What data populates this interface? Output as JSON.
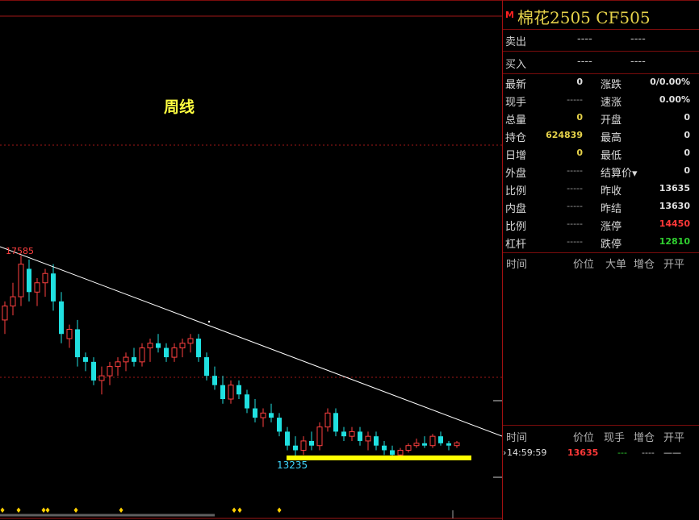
{
  "chart_data": {
    "type": "candlestick",
    "period_label": "周线",
    "high_label": "17585",
    "low_label": "13235",
    "candles": [
      [
        16200,
        16600,
        15900,
        16500
      ],
      [
        16500,
        17000,
        16300,
        16700
      ],
      [
        16700,
        17585,
        16500,
        17400
      ],
      [
        17300,
        17500,
        16600,
        16800
      ],
      [
        16800,
        17100,
        16500,
        17000
      ],
      [
        17000,
        17300,
        16700,
        17200
      ],
      [
        17200,
        17400,
        16400,
        16600
      ],
      [
        16600,
        16800,
        15700,
        15900
      ],
      [
        15800,
        16100,
        15600,
        16000
      ],
      [
        16000,
        16200,
        15200,
        15400
      ],
      [
        15400,
        15500,
        15100,
        15300
      ],
      [
        15300,
        15400,
        14800,
        14900
      ],
      [
        14900,
        15200,
        14600,
        15000
      ],
      [
        15000,
        15300,
        14800,
        15200
      ],
      [
        15200,
        15400,
        15000,
        15300
      ],
      [
        15300,
        15500,
        15100,
        15400
      ],
      [
        15400,
        15600,
        15200,
        15300
      ],
      [
        15300,
        15700,
        15200,
        15600
      ],
      [
        15600,
        15800,
        15300,
        15700
      ],
      [
        15700,
        15900,
        15500,
        15600
      ],
      [
        15600,
        15700,
        15300,
        15400
      ],
      [
        15400,
        15700,
        15300,
        15600
      ],
      [
        15600,
        15800,
        15400,
        15700
      ],
      [
        15700,
        15900,
        15500,
        15800
      ],
      [
        15800,
        15900,
        15300,
        15400
      ],
      [
        15400,
        15500,
        14900,
        15000
      ],
      [
        15000,
        15200,
        14700,
        14800
      ],
      [
        14800,
        15000,
        14400,
        14500
      ],
      [
        14500,
        14900,
        14400,
        14800
      ],
      [
        14800,
        14900,
        14500,
        14600
      ],
      [
        14600,
        14700,
        14200,
        14300
      ],
      [
        14300,
        14500,
        14000,
        14100
      ],
      [
        14100,
        14300,
        13900,
        14200
      ],
      [
        14200,
        14400,
        14000,
        14100
      ],
      [
        14100,
        14200,
        13700,
        13800
      ],
      [
        13800,
        13900,
        13400,
        13500
      ],
      [
        13500,
        13700,
        13235,
        13400
      ],
      [
        13400,
        13700,
        13300,
        13600
      ],
      [
        13600,
        13800,
        13400,
        13500
      ],
      [
        13500,
        14000,
        13400,
        13900
      ],
      [
        13900,
        14300,
        13800,
        14200
      ],
      [
        14200,
        14300,
        13700,
        13800
      ],
      [
        13800,
        13900,
        13600,
        13700
      ],
      [
        13700,
        13900,
        13600,
        13800
      ],
      [
        13800,
        13900,
        13500,
        13600
      ],
      [
        13600,
        13800,
        13400,
        13700
      ],
      [
        13700,
        13800,
        13400,
        13500
      ],
      [
        13500,
        13600,
        13300,
        13400
      ],
      [
        13400,
        13500,
        13250,
        13300
      ],
      [
        13300,
        13450,
        13250,
        13400
      ],
      [
        13400,
        13550,
        13350,
        13500
      ],
      [
        13500,
        13650,
        13450,
        13550
      ],
      [
        13550,
        13700,
        13450,
        13500
      ],
      [
        13500,
        13750,
        13450,
        13700
      ],
      [
        13700,
        13800,
        13500,
        13550
      ],
      [
        13550,
        13600,
        13400,
        13500
      ],
      [
        13500,
        13600,
        13450,
        13560
      ]
    ],
    "colors": {
      "up": "#ff4040",
      "down": "#20e0e0",
      "trendline": "#ffffff",
      "support": "#ffff00",
      "grid": "#a01818"
    }
  },
  "panel": {
    "title": "棉花2505  CF505",
    "badge": "M",
    "sell": {
      "label": "卖出",
      "price": "----",
      "volume": "----"
    },
    "buy": {
      "label": "买入",
      "price": "----",
      "volume": "----"
    },
    "rows": [
      {
        "l1": "最新",
        "v1": "0",
        "v1c": "white",
        "l2": "涨跌",
        "v2": "0/0.00%",
        "v2c": "white"
      },
      {
        "l1": "现手",
        "v1": "-----",
        "v1c": "dash",
        "l2": "速涨",
        "v2": "0.00%",
        "v2c": "white"
      },
      {
        "l1": "总量",
        "v1": "0",
        "v1c": "yellow",
        "l2": "开盘",
        "v2": "0",
        "v2c": "white"
      },
      {
        "l1": "持仓",
        "v1": "624839",
        "v1c": "yellow",
        "l2": "最高",
        "v2": "0",
        "v2c": "white"
      },
      {
        "l1": "日增",
        "v1": "0",
        "v1c": "yellow",
        "l2": "最低",
        "v2": "0",
        "v2c": "white"
      },
      {
        "l1": "外盘",
        "v1": "-----",
        "v1c": "dash",
        "l2": "结算价▾",
        "v2": "0",
        "v2c": "white"
      },
      {
        "l1": "比例",
        "v1": "-----",
        "v1c": "dash",
        "l2": "昨收",
        "v2": "13635",
        "v2c": "white"
      },
      {
        "l1": "内盘",
        "v1": "-----",
        "v1c": "dash",
        "l2": "昨结",
        "v2": "13630",
        "v2c": "white"
      },
      {
        "l1": "比例",
        "v1": "-----",
        "v1c": "dash",
        "l2": "涨停",
        "v2": "14450",
        "v2c": "red"
      },
      {
        "l1": "杠杆",
        "v1": "-----",
        "v1c": "dash",
        "l2": "跌停",
        "v2": "12810",
        "v2c": "green"
      }
    ],
    "header1": {
      "time": "时间",
      "price": "价位",
      "big": "大单",
      "oi": "增仓",
      "oc": "开平"
    },
    "header2": {
      "time": "时间",
      "price": "价位",
      "vol": "现手",
      "oi": "增仓",
      "oc": "开平"
    },
    "tick": {
      "time": "14:59:59",
      "price": "13635",
      "vol": "---",
      "oi": "----",
      "oc": "——"
    }
  }
}
